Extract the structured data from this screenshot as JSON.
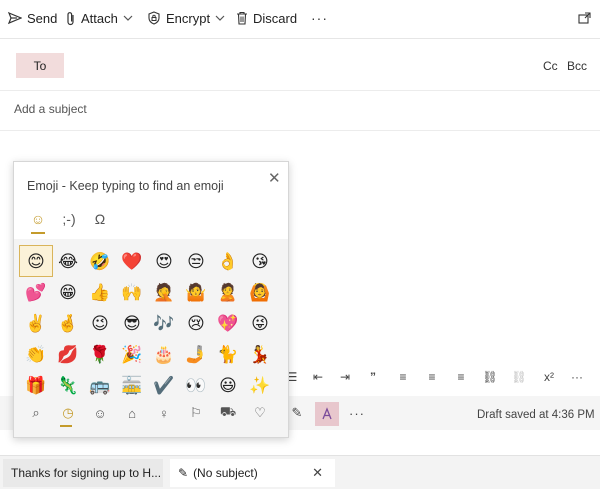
{
  "toolbar": {
    "send_label": "Send",
    "attach_label": "Attach",
    "encrypt_label": "Encrypt",
    "discard_label": "Discard",
    "more_label": "···"
  },
  "compose": {
    "to_label": "To",
    "cc_label": "Cc",
    "bcc_label": "Bcc",
    "subject_placeholder": "Add a subject",
    "draft_status": "Draft saved at 4:36 PM",
    "format_more": "···"
  },
  "emoji_panel": {
    "title": "Emoji - Keep typing to find an emoji",
    "close_label": "✕",
    "tabs": [
      {
        "icon": "smiley-icon",
        "glyph": "☺"
      },
      {
        "icon": "emoticon-icon",
        "glyph": ";-)"
      },
      {
        "icon": "omega-symbol-icon",
        "glyph": "Ω"
      }
    ],
    "emojis": [
      "😊",
      "😂",
      "🤣",
      "❤️",
      "😍",
      "😒",
      "👌",
      "😘",
      "💕",
      "😁",
      "👍",
      "🙌",
      "🤦",
      "🤷",
      "🙎",
      "🙆",
      "✌️",
      "🤞",
      "😉",
      "😎",
      "🎶",
      "😢",
      "💖",
      "😜",
      "👏",
      "💋",
      "🌹",
      "🎉",
      "🎂",
      "🤳",
      "🐈",
      "💃",
      "🎁",
      "🦎",
      "🚌",
      "🚋",
      "✔️",
      "👀",
      "😃",
      "✨"
    ],
    "bottom_categories": [
      {
        "icon": "search-icon",
        "glyph": "⌕"
      },
      {
        "icon": "recent-icon",
        "glyph": "◷"
      },
      {
        "icon": "people-icon",
        "glyph": "☺"
      },
      {
        "icon": "celebration-icon",
        "glyph": "⌂"
      },
      {
        "icon": "food-icon",
        "glyph": "♀"
      },
      {
        "icon": "flag-icon",
        "glyph": "⚐"
      },
      {
        "icon": "travel-icon",
        "glyph": "⛟"
      },
      {
        "icon": "heart-icon",
        "glyph": "♡"
      }
    ]
  },
  "tabs": [
    {
      "label": "Thanks for signing up to H..."
    },
    {
      "label": "(No subject)"
    }
  ],
  "colors": {
    "accent": "#c49b2b",
    "to_button": "#f2dcdc",
    "highlight": "#e8c7cd"
  }
}
